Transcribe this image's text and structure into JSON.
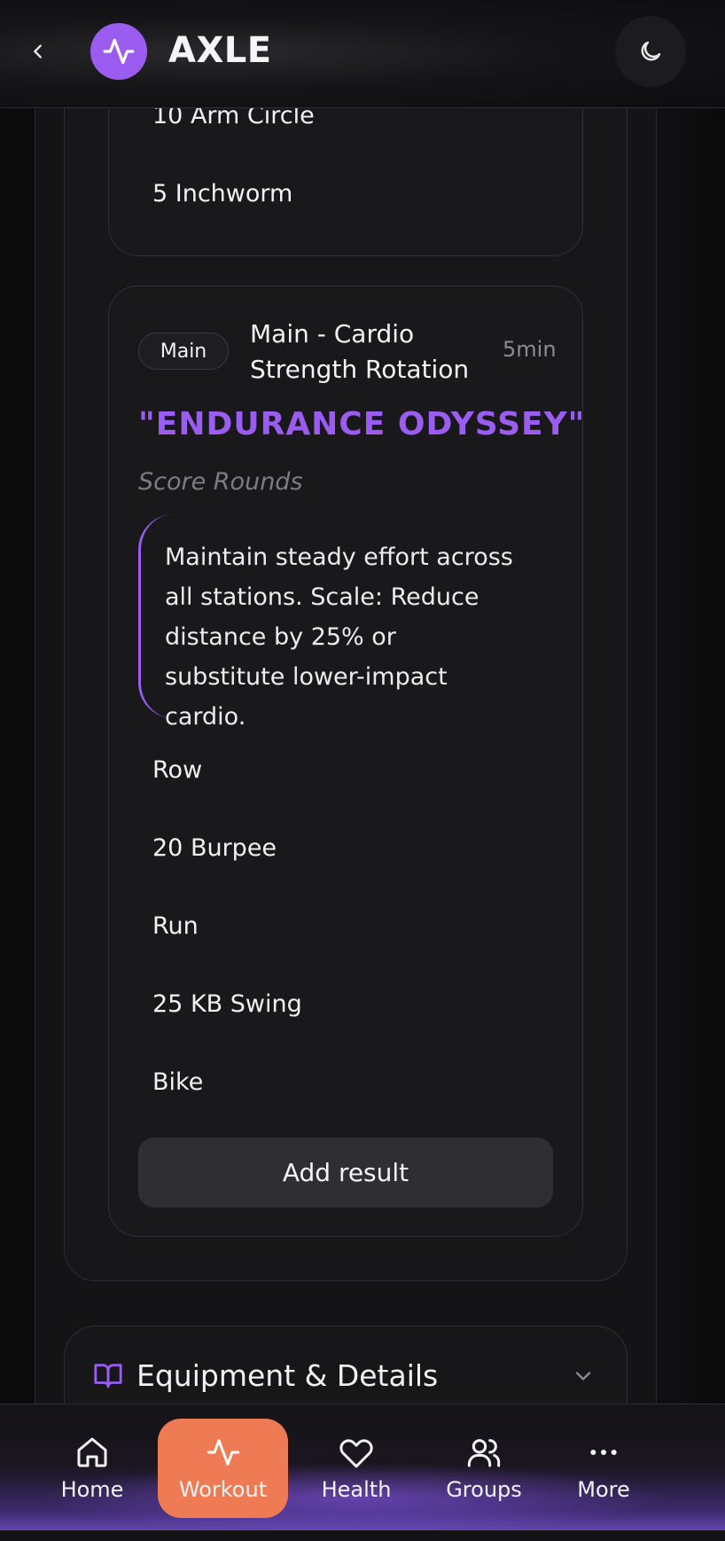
{
  "header": {
    "app_title": "AXLE"
  },
  "warmup": {
    "items": [
      "10 Arm Circle",
      "5 Inchworm"
    ]
  },
  "main_section": {
    "badge": "Main",
    "name": "Main - Cardio Strength Rotation",
    "duration": "5min",
    "workout_title": "\"ENDURANCE ODYSSEY\"",
    "score_type": "Score Rounds",
    "note": "Maintain steady effort across all stations. Scale: Reduce distance by 25% or substitute lower-impact cardio.",
    "exercises": [
      "Row",
      "20 Burpee",
      "Run",
      "25 KB Swing",
      "Bike"
    ],
    "add_result_label": "Add result"
  },
  "equipment": {
    "label": "Equipment & Details"
  },
  "nav": {
    "items": [
      {
        "label": "Home",
        "icon": "home-icon"
      },
      {
        "label": "Workout",
        "icon": "activity-icon",
        "active": true
      },
      {
        "label": "Health",
        "icon": "heart-icon"
      },
      {
        "label": "Groups",
        "icon": "users-icon"
      },
      {
        "label": "More",
        "icon": "more-icon"
      }
    ]
  },
  "colors": {
    "accent": "#9b5cf0",
    "active_nav": "#ef7b55",
    "background": "#141417"
  }
}
